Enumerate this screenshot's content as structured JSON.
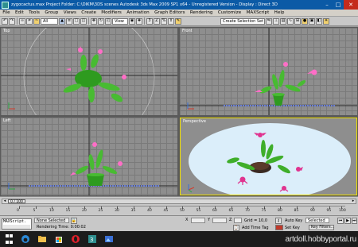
{
  "title_bar": {
    "text": "zygocactus.max      Project Folder: C:\\DIKM\\3DS scenes      Autodesk 3ds Max 2009 SP1 x64  -  Unregistered Version      -  Display : Direct 3D",
    "minimize": "–",
    "maximize": "□",
    "close": "✕"
  },
  "menu": [
    "File",
    "Edit",
    "Tools",
    "Group",
    "Views",
    "Create",
    "Modifiers",
    "Animation",
    "Graph Editors",
    "Rendering",
    "Customize",
    "MAXScript",
    "Help"
  ],
  "toolbar": {
    "filter_dropdown": "All",
    "view_dropdown": "View",
    "selection_set_dropdown": "Create Selection Set"
  },
  "viewports": {
    "top_label": "Top",
    "front_label": "Front",
    "left_label": "Left",
    "perspective_label": "Perspective"
  },
  "timeline": {
    "frame_counter": "0 / 100",
    "ticks": [
      "0",
      "5",
      "10",
      "15",
      "20",
      "25",
      "30",
      "35",
      "40",
      "45",
      "50",
      "55",
      "60",
      "65",
      "70",
      "75",
      "80",
      "85",
      "90",
      "95",
      "100"
    ]
  },
  "status": {
    "maxscript_input": "MAXScript.",
    "selection_status": "None Selected",
    "prompt": "Rendering Time: 0:00:02",
    "grid": "Grid = 10,0",
    "add_time_tag": "Add Time Tag",
    "auto_key": "Auto Key",
    "set_key": "Set Key",
    "key_mode_dropdown": "Selected",
    "key_filters": "Key Filters..."
  },
  "watermark": "artdoll.hobbyportal.ru",
  "colors": {
    "title_bar": "#0b5aa6",
    "viewport_bg": "#8e8e8e",
    "active_viewport_border": "#f0e000",
    "plant_green": "#3fae2a",
    "flower_pink": "#ff6ec7",
    "taskbar": "#1c1c1c"
  }
}
